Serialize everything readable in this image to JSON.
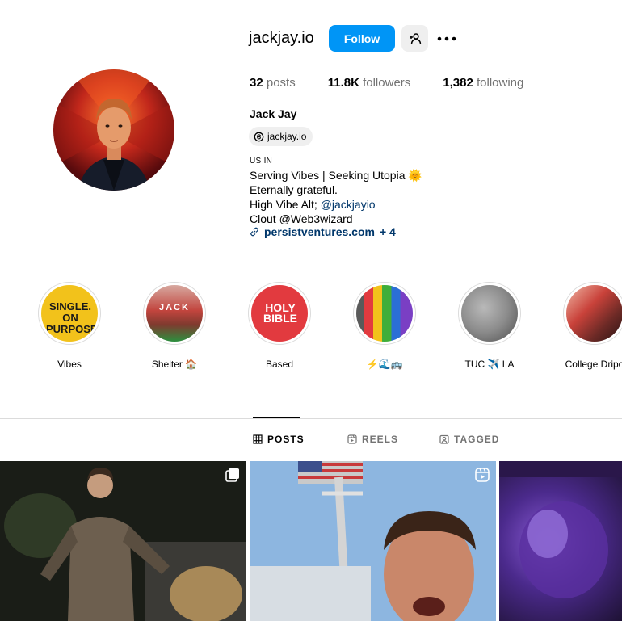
{
  "profile": {
    "username": "jackjay.io",
    "follow_label": "Follow",
    "stats": {
      "posts_count": "32",
      "posts_label": "posts",
      "followers_count": "11.8K",
      "followers_label": "followers",
      "following_count": "1,382",
      "following_label": "following"
    },
    "full_name": "Jack Jay",
    "threads_handle": "jackjay.io",
    "category": "US IN",
    "bio_lines": [
      "Serving Vibes | Seeking Utopia 🌞",
      "Eternally grateful.",
      "High Vibe Alt; ",
      "Clout @Web3wizard"
    ],
    "bio_mention": "@jackjayio",
    "external_link": "persistventures.com",
    "external_link_more": "+ 4"
  },
  "highlights": [
    {
      "name": "Vibes",
      "cover_text": "SINGLE. ON PURPOSE."
    },
    {
      "name": "Shelter 🏠",
      "cover_text": "JACK"
    },
    {
      "name": "Based",
      "cover_text": "HOLY BIBLE"
    },
    {
      "name": "⚡🌊🚌",
      "cover_text": ""
    },
    {
      "name": "TUC ✈️ LA",
      "cover_text": ""
    },
    {
      "name": "College Dripo",
      "cover_text": ""
    }
  ],
  "tabs": {
    "posts": "POSTS",
    "reels": "REELS",
    "tagged": "TAGGED"
  },
  "colors": {
    "accent": "#0095f6",
    "link": "#00376b",
    "muted": "#737373"
  }
}
